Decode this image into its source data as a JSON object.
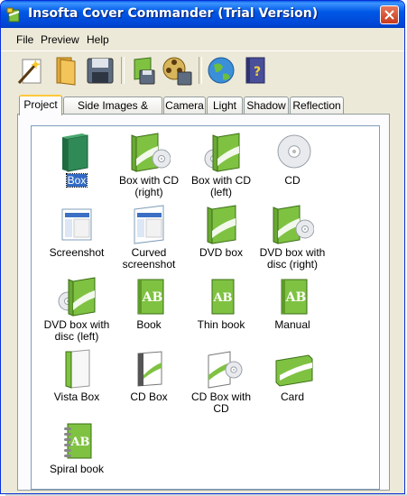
{
  "window": {
    "title": "Insofta Cover Commander (Trial Version)"
  },
  "menu": [
    "File",
    "Preview",
    "Help"
  ],
  "toolbar": [
    {
      "icon": "magic-wand-icon"
    },
    {
      "icon": "open-folder-icon"
    },
    {
      "icon": "save-icon"
    },
    {
      "icon": "save-image-icon"
    },
    {
      "icon": "save-animation-icon"
    },
    {
      "icon": "web-globe-icon"
    },
    {
      "icon": "help-book-icon"
    }
  ],
  "tabs": [
    "Project",
    "Side Images & Colors",
    "Camera",
    "Light",
    "Shadow",
    "Reflection"
  ],
  "items": [
    {
      "label": "Box",
      "selected": true
    },
    {
      "label": "Box with CD (right)"
    },
    {
      "label": "Box with CD (left)"
    },
    {
      "label": "CD"
    },
    {
      "label": "Screenshot"
    },
    {
      "label": "Curved screenshot"
    },
    {
      "label": "DVD box"
    },
    {
      "label": "DVD box with disc (right)"
    },
    {
      "label": "DVD box with disc (left)"
    },
    {
      "label": "Book"
    },
    {
      "label": "Thin book"
    },
    {
      "label": "Manual"
    },
    {
      "label": "Vista Box"
    },
    {
      "label": "CD Box"
    },
    {
      "label": "CD Box with CD"
    },
    {
      "label": "Card"
    },
    {
      "label": "Spiral book"
    }
  ],
  "colors": {
    "accent_green": "#7fc242",
    "title_blue": "#0058e6",
    "selection": "#316ac5"
  }
}
